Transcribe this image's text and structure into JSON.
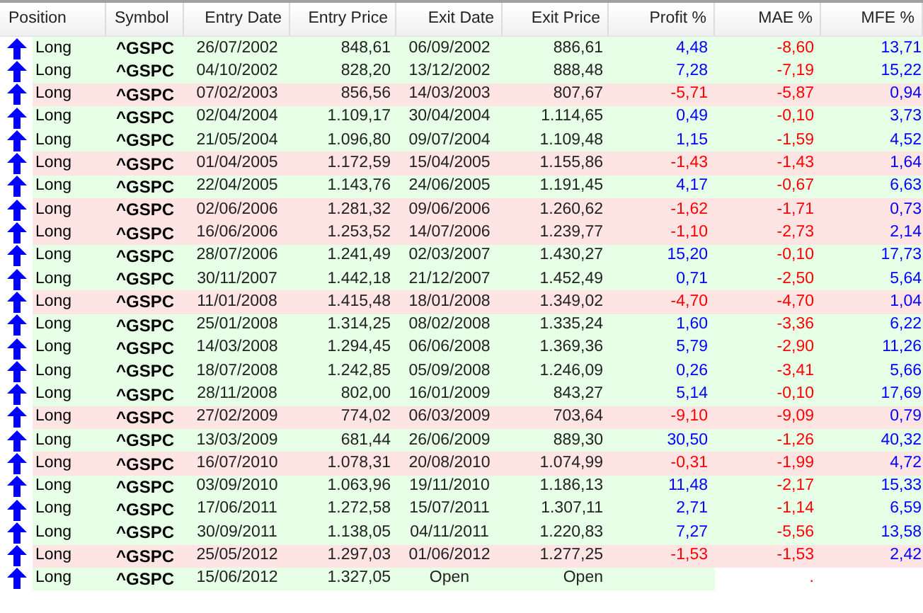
{
  "table": {
    "columns": [
      "Position",
      "Symbol",
      "Entry Date",
      "Entry Price",
      "Exit Date",
      "Exit Price",
      "Profit %",
      "MAE %",
      "MFE %"
    ],
    "rows": [
      {
        "kind": "win",
        "position": "Long",
        "symbol": "^GSPC",
        "entry_date": "26/07/2002",
        "entry_price": "848,61",
        "exit_date": "06/09/2002",
        "exit_price": "886,61",
        "profit": "4,48",
        "mae": "-8,60",
        "mfe": "13,71"
      },
      {
        "kind": "win",
        "position": "Long",
        "symbol": "^GSPC",
        "entry_date": "04/10/2002",
        "entry_price": "828,20",
        "exit_date": "13/12/2002",
        "exit_price": "888,48",
        "profit": "7,28",
        "mae": "-7,19",
        "mfe": "15,22"
      },
      {
        "kind": "loss",
        "position": "Long",
        "symbol": "^GSPC",
        "entry_date": "07/02/2003",
        "entry_price": "856,56",
        "exit_date": "14/03/2003",
        "exit_price": "807,67",
        "profit": "-5,71",
        "mae": "-5,87",
        "mfe": "0,94"
      },
      {
        "kind": "win",
        "position": "Long",
        "symbol": "^GSPC",
        "entry_date": "02/04/2004",
        "entry_price": "1.109,17",
        "exit_date": "30/04/2004",
        "exit_price": "1.114,65",
        "profit": "0,49",
        "mae": "-0,10",
        "mfe": "3,73"
      },
      {
        "kind": "win",
        "position": "Long",
        "symbol": "^GSPC",
        "entry_date": "21/05/2004",
        "entry_price": "1.096,80",
        "exit_date": "09/07/2004",
        "exit_price": "1.109,48",
        "profit": "1,15",
        "mae": "-1,59",
        "mfe": "4,52"
      },
      {
        "kind": "loss",
        "position": "Long",
        "symbol": "^GSPC",
        "entry_date": "01/04/2005",
        "entry_price": "1.172,59",
        "exit_date": "15/04/2005",
        "exit_price": "1.155,86",
        "profit": "-1,43",
        "mae": "-1,43",
        "mfe": "1,64"
      },
      {
        "kind": "win",
        "position": "Long",
        "symbol": "^GSPC",
        "entry_date": "22/04/2005",
        "entry_price": "1.143,76",
        "exit_date": "24/06/2005",
        "exit_price": "1.191,45",
        "profit": "4,17",
        "mae": "-0,67",
        "mfe": "6,63"
      },
      {
        "kind": "loss",
        "position": "Long",
        "symbol": "^GSPC",
        "entry_date": "02/06/2006",
        "entry_price": "1.281,32",
        "exit_date": "09/06/2006",
        "exit_price": "1.260,62",
        "profit": "-1,62",
        "mae": "-1,71",
        "mfe": "0,73"
      },
      {
        "kind": "loss",
        "position": "Long",
        "symbol": "^GSPC",
        "entry_date": "16/06/2006",
        "entry_price": "1.253,52",
        "exit_date": "14/07/2006",
        "exit_price": "1.239,77",
        "profit": "-1,10",
        "mae": "-2,73",
        "mfe": "2,14"
      },
      {
        "kind": "win",
        "position": "Long",
        "symbol": "^GSPC",
        "entry_date": "28/07/2006",
        "entry_price": "1.241,49",
        "exit_date": "02/03/2007",
        "exit_price": "1.430,27",
        "profit": "15,20",
        "mae": "-0,10",
        "mfe": "17,73"
      },
      {
        "kind": "win",
        "position": "Long",
        "symbol": "^GSPC",
        "entry_date": "30/11/2007",
        "entry_price": "1.442,18",
        "exit_date": "21/12/2007",
        "exit_price": "1.452,49",
        "profit": "0,71",
        "mae": "-2,50",
        "mfe": "5,64"
      },
      {
        "kind": "loss",
        "position": "Long",
        "symbol": "^GSPC",
        "entry_date": "11/01/2008",
        "entry_price": "1.415,48",
        "exit_date": "18/01/2008",
        "exit_price": "1.349,02",
        "profit": "-4,70",
        "mae": "-4,70",
        "mfe": "1,04"
      },
      {
        "kind": "win",
        "position": "Long",
        "symbol": "^GSPC",
        "entry_date": "25/01/2008",
        "entry_price": "1.314,25",
        "exit_date": "08/02/2008",
        "exit_price": "1.335,24",
        "profit": "1,60",
        "mae": "-3,36",
        "mfe": "6,22"
      },
      {
        "kind": "win",
        "position": "Long",
        "symbol": "^GSPC",
        "entry_date": "14/03/2008",
        "entry_price": "1.294,45",
        "exit_date": "06/06/2008",
        "exit_price": "1.369,36",
        "profit": "5,79",
        "mae": "-2,90",
        "mfe": "11,26"
      },
      {
        "kind": "win",
        "position": "Long",
        "symbol": "^GSPC",
        "entry_date": "18/07/2008",
        "entry_price": "1.242,85",
        "exit_date": "05/09/2008",
        "exit_price": "1.246,09",
        "profit": "0,26",
        "mae": "-3,41",
        "mfe": "5,66"
      },
      {
        "kind": "win",
        "position": "Long",
        "symbol": "^GSPC",
        "entry_date": "28/11/2008",
        "entry_price": "802,00",
        "exit_date": "16/01/2009",
        "exit_price": "843,27",
        "profit": "5,14",
        "mae": "-0,10",
        "mfe": "17,69"
      },
      {
        "kind": "loss",
        "position": "Long",
        "symbol": "^GSPC",
        "entry_date": "27/02/2009",
        "entry_price": "774,02",
        "exit_date": "06/03/2009",
        "exit_price": "703,64",
        "profit": "-9,10",
        "mae": "-9,09",
        "mfe": "0,79"
      },
      {
        "kind": "win",
        "position": "Long",
        "symbol": "^GSPC",
        "entry_date": "13/03/2009",
        "entry_price": "681,44",
        "exit_date": "26/06/2009",
        "exit_price": "889,30",
        "profit": "30,50",
        "mae": "-1,26",
        "mfe": "40,32"
      },
      {
        "kind": "loss",
        "position": "Long",
        "symbol": "^GSPC",
        "entry_date": "16/07/2010",
        "entry_price": "1.078,31",
        "exit_date": "20/08/2010",
        "exit_price": "1.074,99",
        "profit": "-0,31",
        "mae": "-1,99",
        "mfe": "4,72"
      },
      {
        "kind": "win",
        "position": "Long",
        "symbol": "^GSPC",
        "entry_date": "03/09/2010",
        "entry_price": "1.063,96",
        "exit_date": "19/11/2010",
        "exit_price": "1.186,13",
        "profit": "11,48",
        "mae": "-2,17",
        "mfe": "15,33"
      },
      {
        "kind": "win",
        "position": "Long",
        "symbol": "^GSPC",
        "entry_date": "17/06/2011",
        "entry_price": "1.272,58",
        "exit_date": "15/07/2011",
        "exit_price": "1.307,11",
        "profit": "2,71",
        "mae": "-1,14",
        "mfe": "6,59"
      },
      {
        "kind": "win",
        "position": "Long",
        "symbol": "^GSPC",
        "entry_date": "30/09/2011",
        "entry_price": "1.138,05",
        "exit_date": "04/11/2011",
        "exit_price": "1.220,83",
        "profit": "7,27",
        "mae": "-5,56",
        "mfe": "13,58"
      },
      {
        "kind": "loss",
        "position": "Long",
        "symbol": "^GSPC",
        "entry_date": "25/05/2012",
        "entry_price": "1.297,03",
        "exit_date": "01/06/2012",
        "exit_price": "1.277,25",
        "profit": "-1,53",
        "mae": "-1,53",
        "mfe": "2,42"
      },
      {
        "kind": "open",
        "position": "Long",
        "symbol": "^GSPC",
        "entry_date": "15/06/2012",
        "entry_price": "1.327,05",
        "exit_date": "Open",
        "exit_price": "Open",
        "mae": "."
      }
    ]
  }
}
